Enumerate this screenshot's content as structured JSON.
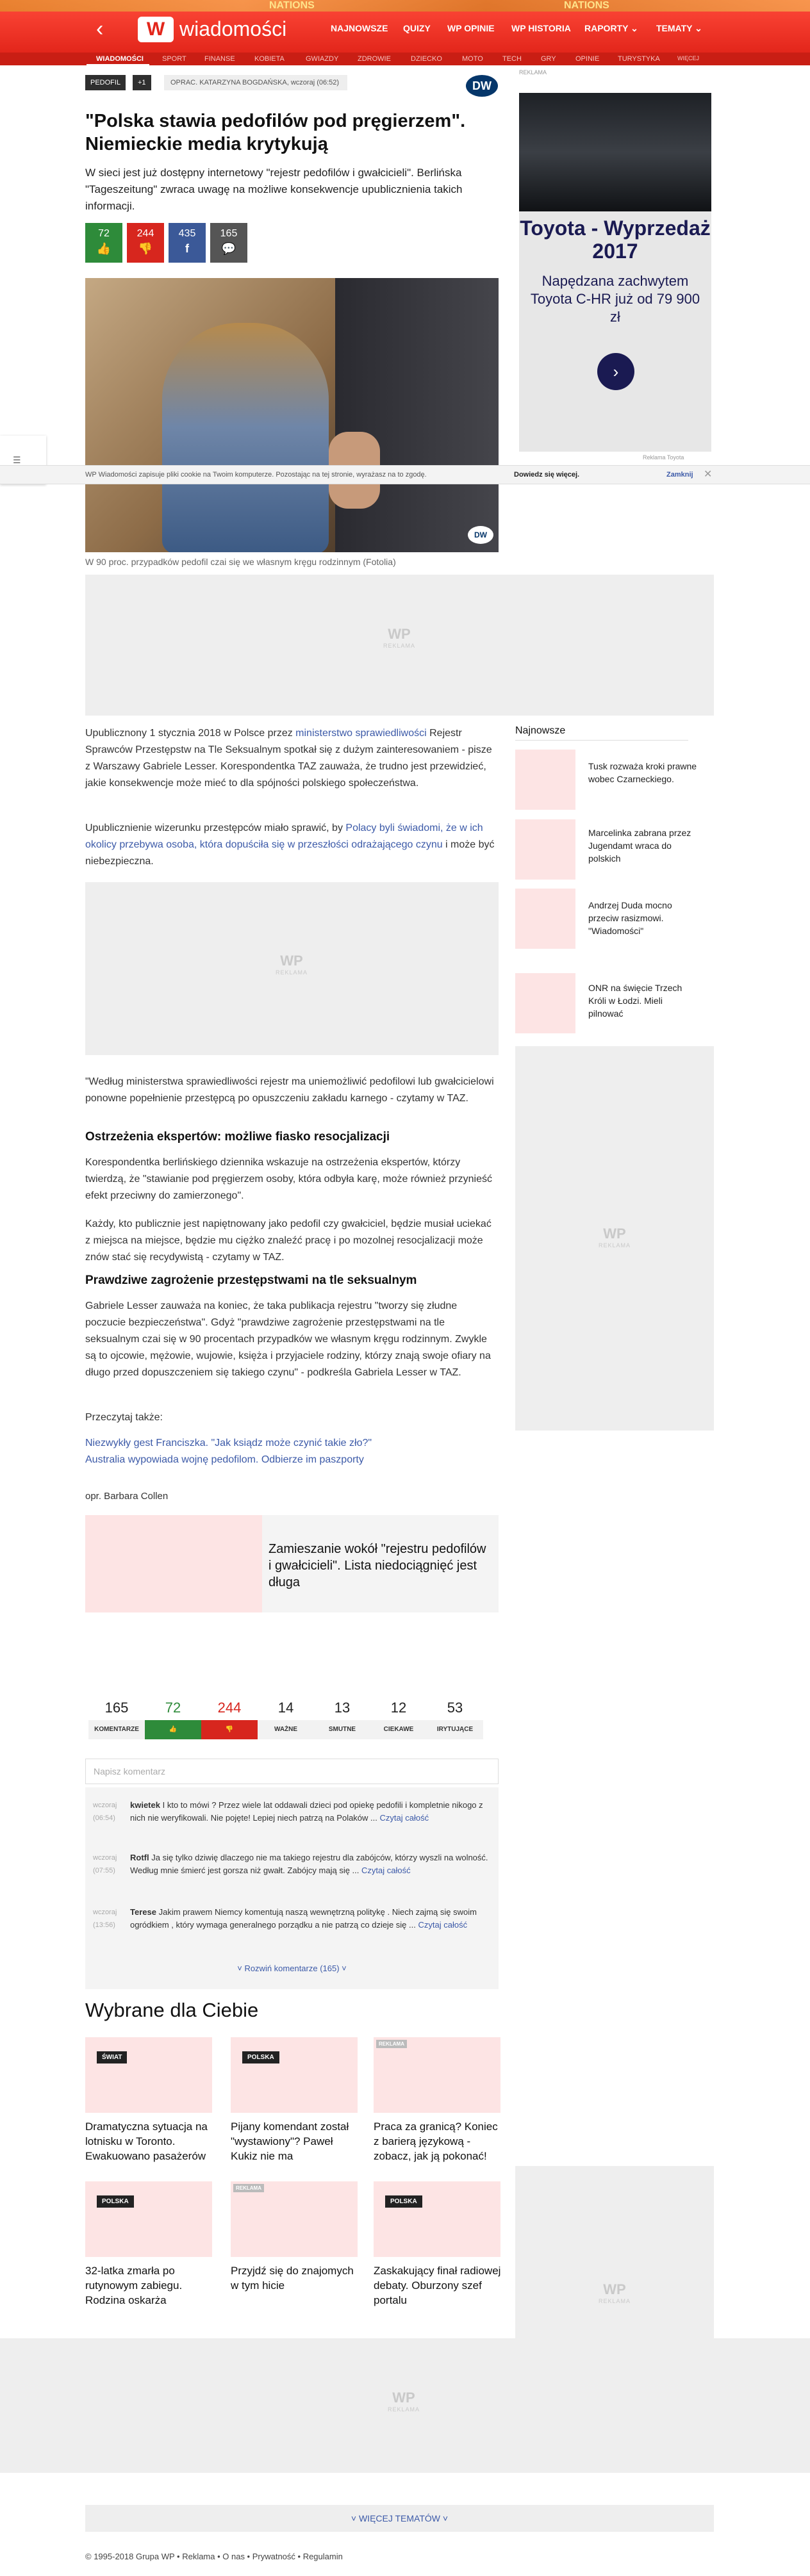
{
  "header": {
    "logo_letter": "W",
    "logo_text": "wiadomości",
    "nav": [
      "NAJNOWSZE",
      "QUIZY",
      "WP OPINIE",
      "WP HISTORIA",
      "RAPORTY ⌄",
      "TEMATY ⌄"
    ],
    "subnav": [
      "WIADOMOŚCI",
      "SPORT",
      "FINANSE",
      "KOBIETA",
      "GWIAZDY",
      "ZDROWIE",
      "DZIECKO",
      "MOTO",
      "TECH",
      "GRY",
      "OPINIE",
      "TURYSTYKA",
      "WIĘCEJ"
    ],
    "strip_text": "NATIONS"
  },
  "article": {
    "tags": [
      "PEDOFIL",
      "+1"
    ],
    "author": "OPRAC. KATARZYNA BOGDAŃSKA, wczoraj (06:52)",
    "source_badge": "DW",
    "title": "\"Polska stawia pedofilów pod pręgierzem\". Niemieckie media krytykują",
    "lead": "W sieci jest już dostępny internetowy \"rejestr pedofilów i gwałcicieli\". Berlińska \"Tageszeitung\" zwraca uwagę na możliwe konsekwencje upublicznienia takich informacji.",
    "votes": [
      {
        "count": "72",
        "icon": "👍",
        "color": "#2e8b3a"
      },
      {
        "count": "244",
        "icon": "👎",
        "color": "#d7261e"
      },
      {
        "count": "435",
        "icon": "f",
        "color": "#3b5998"
      },
      {
        "count": "165",
        "icon": "💬",
        "color": "#555555"
      }
    ],
    "caption": "W 90 proc. przypadków pedofil czai się we własnym kręgu rodzinnym (Fotolia)",
    "p1_a": "Upublicznony 1 stycznia 2018 w Polsce przez ",
    "p1_link": "ministerstwo sprawiedliwości",
    "p1_b": " Rejestr Sprawców Przestępstw na Tle Seksualnym spotkał się z dużym zainteresowaniem - pisze z Warszawy Gabriele Lesser. Korespondentka TAZ zauważa, że trudno jest przewidzieć, jakie konsekwencje może mieć to dla spójności polskiego społeczeństwa.",
    "p2_a": "Upublicznienie wizerunku przestępców miało sprawić, by ",
    "p2_link": "Polacy byli świadomi, że w ich okolicy przebywa osoba, która dopuściła się w przeszłości odrażającego czynu",
    "p2_b": " i może być niebezpieczna.",
    "p3": "\"Według ministerstwa sprawiedliwości rejestr ma uniemożliwić pedofilowi lub gwałcicielowi ponowne popełnienie przestępcą po opuszczeniu zakładu karnego - czytamy w TAZ.",
    "h_1": "Ostrzeżenia ekspertów: możliwe fiasko resocjalizacji",
    "p4": "Korespondentka berlińskiego dziennika wskazuje na ostrzeżenia ekspertów, którzy twierdzą, że \"stawianie pod pręgierzem osoby, która odbyła karę, może również przynieść efekt przeciwny do zamierzonego\".",
    "p5": "Każdy, kto publicznie jest napiętnowany jako pedofil czy gwałciciel, będzie musiał uciekać z miejsca na miejsce, będzie mu ciężko znaleźć pracę i po mozolnej resocjalizacji może znów stać się recydywistą - czytamy w TAZ.",
    "h_2": "Prawdziwe zagrożenie przestępstwami na tle seksualnym",
    "p6": "Gabriele Lesser zauważa na koniec, że taka publikacja rejestru \"tworzy się złudne poczucie bezpieczeństwa\". Gdyż \"prawdziwe zagrożenie przestępstwami na tle seksualnym czai się w 90 procentach przypadków we własnym kręgu rodzinnym. Zwykle są to ojcowie, mężowie, wujowie, księża i przyjaciele rodziny, którzy znają swoje ofiary na długo przed dopuszczeniem się takiego czynu\" - podkreśla Gabriela Lesser w TAZ.",
    "read_also": "Przeczytaj także:",
    "related": [
      "Niezwykły gest Franciszka. \"Jak ksiądz może czynić takie zło?\"",
      "Australia wypowiada wojnę pedofilom. Odbierze im paszporty"
    ],
    "credit": "opr. Barbara Collen",
    "promo_title": "Zamieszanie wokół \"rejestru pedofilów i gwałcicieli\". Lista niedociągnięć jest długa"
  },
  "cookie": {
    "text": "WP Wiadomości zapisuje pliki cookie na Twoim komputerze. Pozostając na tej stronie, wyrażasz na to zgodę.",
    "more": "Dowiedz się więcej.",
    "close": "Zamknij"
  },
  "ads": {
    "label": "REKLAMA",
    "wp_mark": "WP",
    "toyota_title": "Toyota - Wyprzedaż 2017",
    "toyota_text": "Napędzana zachwytem Toyota C-HR już od 79 900 zł",
    "toyota_note": "Reklama Toyota"
  },
  "sidebar": {
    "heading": "Najnowsze",
    "items": [
      "Tusk rozważa kroki prawne wobec Czarneckiego.",
      "Marcelinka zabrana przez Jugendamt wraca do polskich",
      "Andrzej Duda mocno przeciw rasizmowi. \"Wiadomości\"",
      "ONR na święcie Trzech Króli w Łodzi. Mieli pilnować"
    ]
  },
  "reactions": [
    {
      "n": "165",
      "label": "KOMENTARZE",
      "color": "#222",
      "bg": "#f2f2f2",
      "fg": "#333"
    },
    {
      "n": "72",
      "label": "👍",
      "color": "#2e8b3a",
      "bg": "#2e8b3a",
      "fg": "#fff"
    },
    {
      "n": "244",
      "label": "👎",
      "color": "#d7261e",
      "bg": "#d7261e",
      "fg": "#fff"
    },
    {
      "n": "14",
      "label": "WAŻNE",
      "color": "#222",
      "bg": "#f2f2f2",
      "fg": "#333"
    },
    {
      "n": "13",
      "label": "SMUTNE",
      "color": "#222",
      "bg": "#f2f2f2",
      "fg": "#333"
    },
    {
      "n": "12",
      "label": "CIEKAWE",
      "color": "#222",
      "bg": "#f2f2f2",
      "fg": "#333"
    },
    {
      "n": "53",
      "label": "IRYTUJĄCE",
      "color": "#222",
      "bg": "#f2f2f2",
      "fg": "#333"
    }
  ],
  "comments": {
    "placeholder": "Napisz komentarz",
    "items": [
      {
        "meta": "wczoraj (06:54)",
        "user": "kwietek",
        "text": "I kto to mówi ? Przez wiele lat oddawali dzieci pod opiekę pedofili i kompletnie nikogo z nich nie weryfikowali. Nie pojęte! Lepiej niech patrzą na Polaków ...",
        "more": "Czytaj całość"
      },
      {
        "meta": "wczoraj (07:55)",
        "user": "Rotfl",
        "text": "Ja się tylko dziwię dlaczego nie ma takiego rejestru dla zabójców, którzy wyszli na wolność. Według mnie śmierć jest gorsza niż gwałt. Zabójcy mają się ...",
        "more": "Czytaj całość"
      },
      {
        "meta": "wczoraj (13:56)",
        "user": "Terese",
        "text": "Jakim prawem Niemcy komentują naszą wewnętrzną politykę . Niech zajmą się swoim ogródkiem , który wymaga generalnego porządku a nie patrzą co dzieje się ...",
        "more": "Czytaj całość"
      }
    ],
    "expand": "˅ Rozwiń komentarze (165) ˅"
  },
  "recommended": {
    "heading": "Wybrane dla Ciebie",
    "cards": [
      {
        "badge": "ŚWIAT",
        "title": "Dramatyczna sytuacja na lotnisku w Toronto. Ewakuowano pasażerów",
        "ad": false
      },
      {
        "badge": "POLSKA",
        "title": "Pijany komendant został \"wystawiony\"? Paweł Kukiz nie ma",
        "ad": false
      },
      {
        "badge": "REKLAMA",
        "title": "Praca za granicą? Koniec z barierą językową - zobacz, jak ją pokonać!",
        "ad": true
      },
      {
        "badge": "POLSKA",
        "title": "32-latka zmarła po rutynowym zabiegu. Rodzina oskarża",
        "ad": false
      },
      {
        "badge": "REKLAMA",
        "title": "Przyjdź się do znajomych w tym hicie",
        "ad": true
      },
      {
        "badge": "POLSKA",
        "title": "Zaskakujący finał radiowej debaty. Oburzony szef portalu",
        "ad": false
      }
    ]
  },
  "footer": {
    "more_topics": "˅ WIĘCEJ TEMATÓW ˅",
    "links": "© 1995-2018 Grupa WP  •  Reklama  •  O nas  •  Prywatność  •  Regulamin"
  }
}
